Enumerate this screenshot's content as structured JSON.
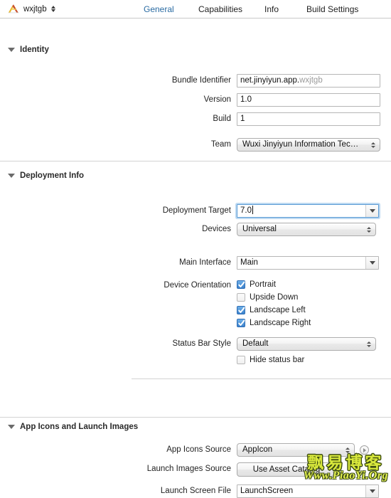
{
  "window": {
    "project_name": "wxjtgb",
    "project_icon": "xcode-app-icon"
  },
  "tabs": [
    {
      "label": "General",
      "selected": true
    },
    {
      "label": "Capabilities",
      "selected": false
    },
    {
      "label": "Info",
      "selected": false
    },
    {
      "label": "Build Settings",
      "selected": false
    }
  ],
  "sections": {
    "identity": {
      "title": "Identity",
      "fields": {
        "bundle_identifier_label": "Bundle Identifier",
        "bundle_identifier_value": "net.jinyiyun.app.",
        "bundle_identifier_suffix": "wxjtgb",
        "version_label": "Version",
        "version_value": "1.0",
        "build_label": "Build",
        "build_value": "1",
        "team_label": "Team",
        "team_value": "Wuxi Jinyiyun Information Tec…"
      }
    },
    "deployment_info": {
      "title": "Deployment Info",
      "fields": {
        "deployment_target_label": "Deployment Target",
        "deployment_target_value": "7.0",
        "devices_label": "Devices",
        "devices_value": "Universal",
        "main_interface_label": "Main Interface",
        "main_interface_value": "Main",
        "device_orientation_label": "Device Orientation",
        "status_bar_style_label": "Status Bar Style",
        "status_bar_style_value": "Default",
        "hide_status_bar_label": "Hide status bar",
        "hide_status_bar_checked": false
      },
      "orientations": [
        {
          "label": "Portrait",
          "checked": true
        },
        {
          "label": "Upside Down",
          "checked": false
        },
        {
          "label": "Landscape Left",
          "checked": true
        },
        {
          "label": "Landscape Right",
          "checked": true
        }
      ]
    },
    "app_icons": {
      "title": "App Icons and Launch Images",
      "fields": {
        "app_icons_source_label": "App Icons Source",
        "app_icons_source_value": "AppIcon",
        "launch_images_source_label": "Launch Images Source",
        "launch_images_source_button": "Use Asset Catalog",
        "launch_screen_file_label": "Launch Screen File",
        "launch_screen_file_value": "LaunchScreen"
      }
    }
  },
  "watermark": {
    "text_cn": "飘易博客",
    "text_url": "Www.PiaoYi.Org",
    "color": "#d8e83c"
  },
  "colors": {
    "selected_tab": "#2b6ca3",
    "checkbox_on": "#3c82cc",
    "focus_ring": "#6caae0",
    "divider": "#d3d3d3"
  }
}
